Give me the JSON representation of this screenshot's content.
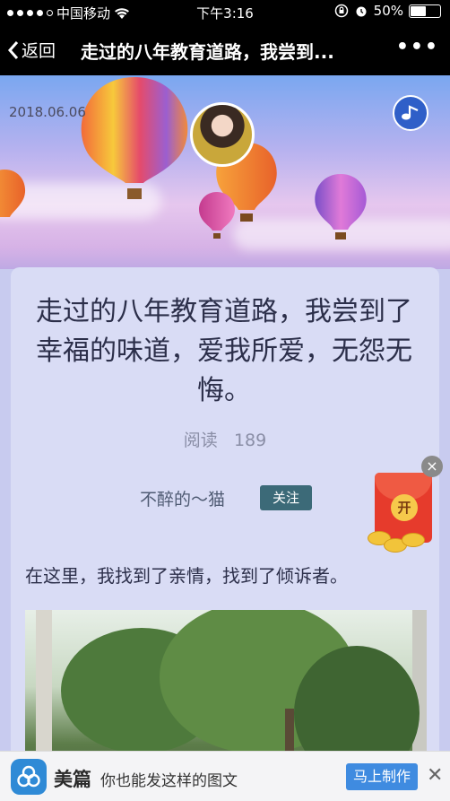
{
  "status_bar": {
    "carrier": "中国移动",
    "time": "下午3:16",
    "battery": "50%",
    "battery_level": 0.5
  },
  "nav": {
    "back_label": "返回",
    "title": "走过的八年教育道路，我尝到...",
    "more_label": "•••"
  },
  "hero": {
    "date": "2018.06.06"
  },
  "article": {
    "title": "走过的八年教育道路，我尝到了幸福的味道，爱我所爱，无怨无悔。",
    "read_label": "阅读",
    "read_count": "189",
    "author": "不醉的～猫",
    "follow_label": "关注",
    "body": "在这里，我找到了亲情，找到了倾诉者。"
  },
  "red_packet": {
    "open_label": "开",
    "close_label": "×"
  },
  "bottom_bar": {
    "brand": "美篇",
    "slogan": "你也能发这样的图文",
    "button": "马上制作",
    "close_label": "✕"
  },
  "icons": [
    "back-chevron-icon",
    "more-icon",
    "music-icon",
    "wifi-icon",
    "alarm-icon",
    "lock-rotation-icon",
    "meipian-logo-icon",
    "close-icon"
  ]
}
